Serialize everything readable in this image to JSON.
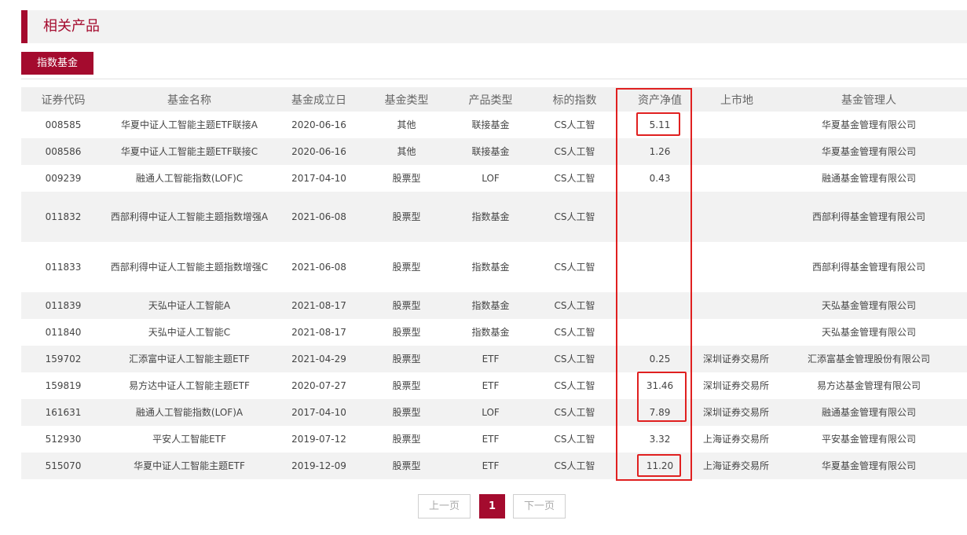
{
  "section": {
    "title": "相关产品"
  },
  "tabs": [
    {
      "label": "指数基金"
    }
  ],
  "table": {
    "headers": [
      "证券代码",
      "基金名称",
      "基金成立日",
      "基金类型",
      "产品类型",
      "标的指数",
      "资产净值",
      "上市地",
      "基金管理人"
    ],
    "rows": [
      [
        "008585",
        "华夏中证人工智能主题ETF联接A",
        "2020-06-16",
        "其他",
        "联接基金",
        "CS人工智",
        "5.11",
        "",
        "华夏基金管理有限公司"
      ],
      [
        "008586",
        "华夏中证人工智能主题ETF联接C",
        "2020-06-16",
        "其他",
        "联接基金",
        "CS人工智",
        "1.26",
        "",
        "华夏基金管理有限公司"
      ],
      [
        "009239",
        "融通人工智能指数(LOF)C",
        "2017-04-10",
        "股票型",
        "LOF",
        "CS人工智",
        "0.43",
        "",
        "融通基金管理有限公司"
      ],
      [
        "011832",
        "西部利得中证人工智能主题指数增强A",
        "2021-06-08",
        "股票型",
        "指数基金",
        "CS人工智",
        "",
        "",
        "西部利得基金管理有限公司"
      ],
      [
        "011833",
        "西部利得中证人工智能主题指数增强C",
        "2021-06-08",
        "股票型",
        "指数基金",
        "CS人工智",
        "",
        "",
        "西部利得基金管理有限公司"
      ],
      [
        "011839",
        "天弘中证人工智能A",
        "2021-08-17",
        "股票型",
        "指数基金",
        "CS人工智",
        "",
        "",
        "天弘基金管理有限公司"
      ],
      [
        "011840",
        "天弘中证人工智能C",
        "2021-08-17",
        "股票型",
        "指数基金",
        "CS人工智",
        "",
        "",
        "天弘基金管理有限公司"
      ],
      [
        "159702",
        "汇添富中证人工智能主题ETF",
        "2021-04-29",
        "股票型",
        "ETF",
        "CS人工智",
        "0.25",
        "深圳证券交易所",
        "汇添富基金管理股份有限公司"
      ],
      [
        "159819",
        "易方达中证人工智能主题ETF",
        "2020-07-27",
        "股票型",
        "ETF",
        "CS人工智",
        "31.46",
        "深圳证券交易所",
        "易方达基金管理有限公司"
      ],
      [
        "161631",
        "融通人工智能指数(LOF)A",
        "2017-04-10",
        "股票型",
        "LOF",
        "CS人工智",
        "7.89",
        "深圳证券交易所",
        "融通基金管理有限公司"
      ],
      [
        "512930",
        "平安人工智能ETF",
        "2019-07-12",
        "股票型",
        "ETF",
        "CS人工智",
        "3.32",
        "上海证券交易所",
        "平安基金管理有限公司"
      ],
      [
        "515070",
        "华夏中证人工智能主题ETF",
        "2019-12-09",
        "股票型",
        "ETF",
        "CS人工智",
        "11.20",
        "上海证券交易所",
        "华夏基金管理有限公司"
      ]
    ]
  },
  "pagination": {
    "prev": "上一页",
    "current": "1",
    "next": "下一页"
  },
  "colors": {
    "accent": "#a40b2e",
    "highlight": "#e02020",
    "row_alt": "#f2f2f2",
    "header_bg": "#f0f0f0"
  }
}
